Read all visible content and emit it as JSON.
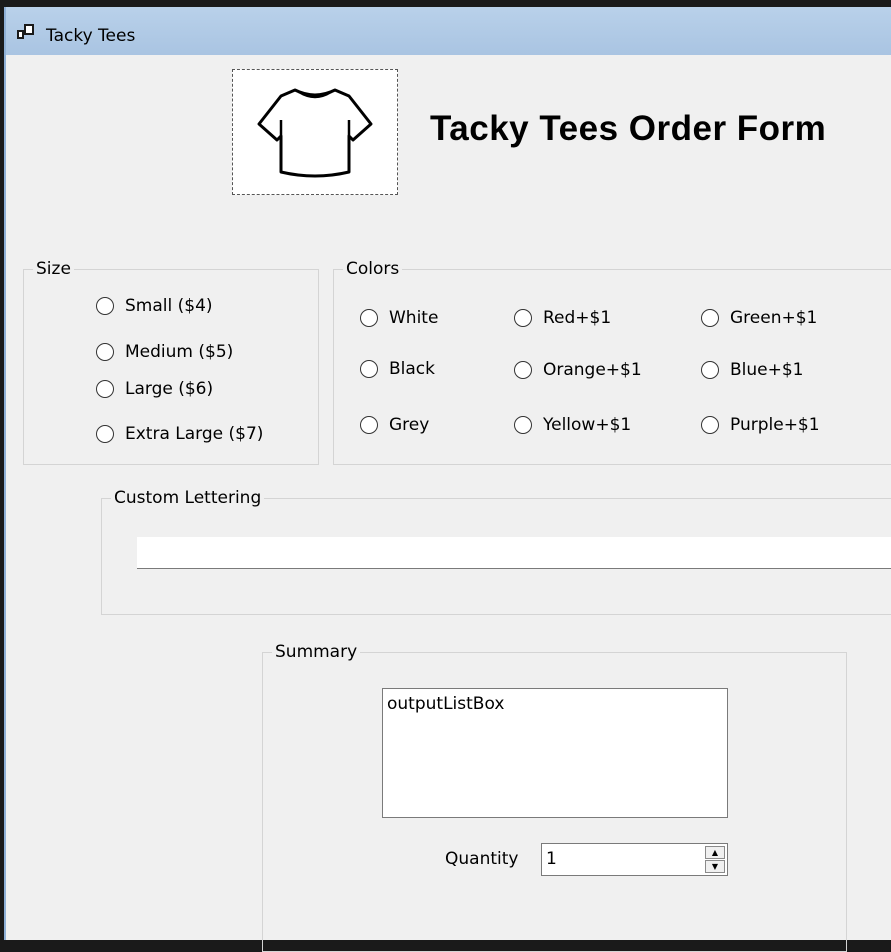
{
  "window": {
    "title": "Tacky Tees"
  },
  "header": {
    "title": "Tacky Tees Order Form",
    "image": "t-shirt-icon"
  },
  "size": {
    "label": "Size",
    "options": [
      "Small ($4)",
      "Medium ($5)",
      "Large ($6)",
      "Extra Large ($7)"
    ]
  },
  "colors": {
    "label": "Colors",
    "options": [
      "White",
      "Black",
      "Grey",
      "Red+$1",
      "Orange+$1",
      "Yellow+$1",
      "Green+$1",
      "Blue+$1",
      "Purple+$1"
    ]
  },
  "custom_lettering": {
    "label": "Custom Lettering",
    "value": ""
  },
  "summary": {
    "label": "Summary",
    "list_text": "outputListBox",
    "quantity_label": "Quantity",
    "quantity_value": "1"
  }
}
